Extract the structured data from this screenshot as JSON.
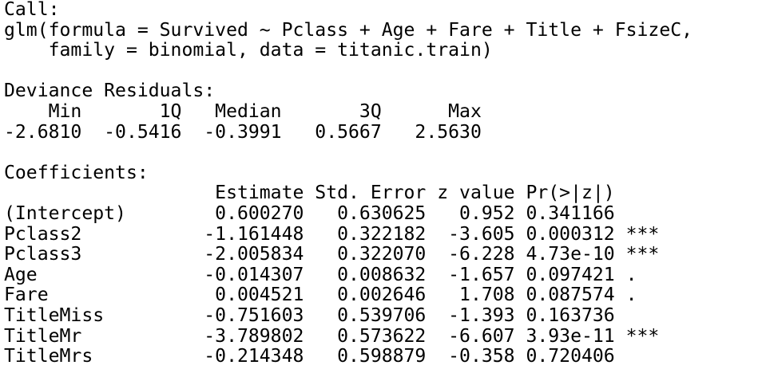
{
  "console": {
    "lines": [
      "Call:",
      "glm(formula = Survived ~ Pclass + Age + Fare + Title + FsizeC,",
      "    family = binomial, data = titanic.train)",
      "",
      "Deviance Residuals:",
      "    Min       1Q   Median       3Q      Max  ",
      "-2.6810  -0.5416  -0.3991   0.5667   2.5630  ",
      "",
      "Coefficients:",
      "                   Estimate Std. Error z value Pr(>|z|)    ",
      "(Intercept)        0.600270   0.630625   0.952 0.341166    ",
      "Pclass2           -1.161448   0.322182  -3.605 0.000312 ***",
      "Pclass3           -2.005834   0.322070  -6.228 4.73e-10 ***",
      "Age               -0.014307   0.008632  -1.657 0.097421 .  ",
      "Fare               0.004521   0.002646   1.708 0.087574 .  ",
      "TitleMiss         -0.751603   0.539706  -1.393 0.163736    ",
      "TitleMr           -3.789802   0.573622  -6.607 3.93e-11 ***",
      "TitleMrs          -0.214348   0.598879  -0.358 0.720406    "
    ]
  }
}
